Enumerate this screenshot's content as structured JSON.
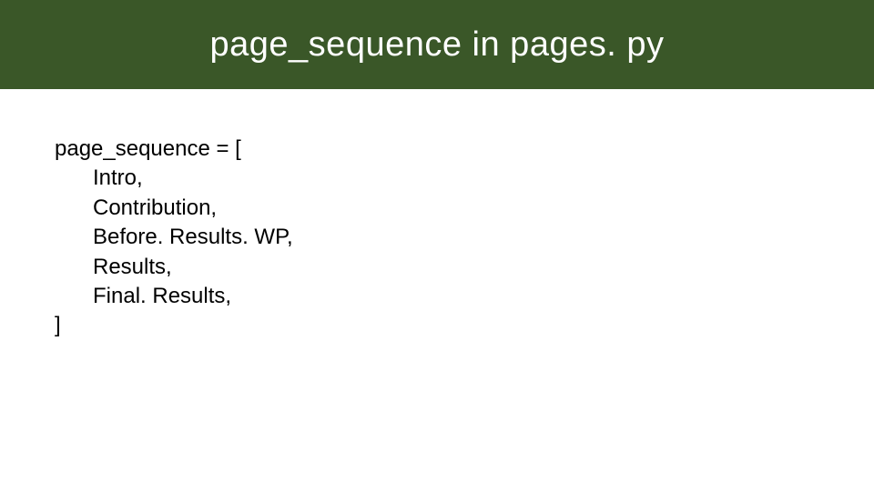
{
  "header": {
    "title": "page_sequence in pages. py"
  },
  "code": {
    "open": "page_sequence = [",
    "items": [
      "Intro,",
      "Contribution,",
      "Before. Results. WP,",
      "Results,",
      "Final. Results,"
    ],
    "close": "]"
  }
}
